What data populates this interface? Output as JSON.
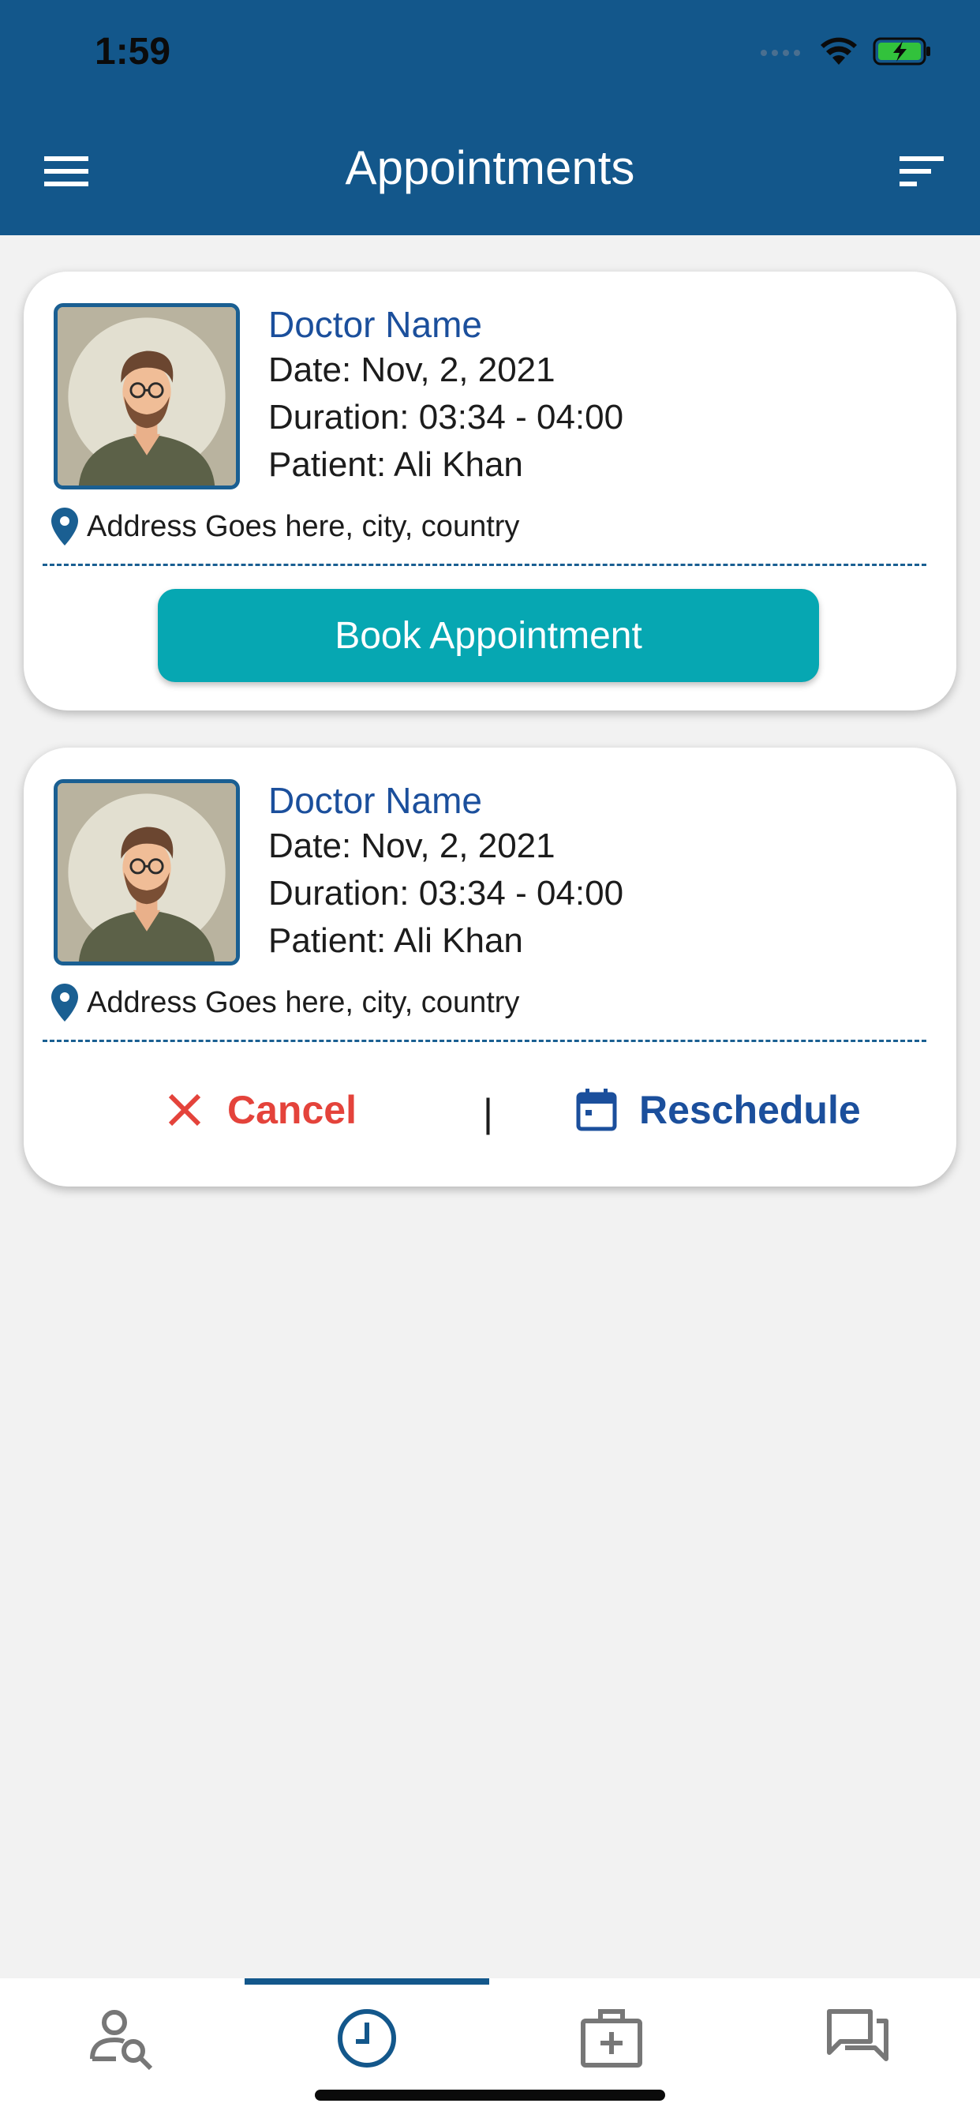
{
  "status_bar": {
    "time": "1:59"
  },
  "header": {
    "title": "Appointments",
    "menu_icon": "hamburger-menu-icon",
    "filter_icon": "filter-sort-icon"
  },
  "colors": {
    "primary": "#13578b",
    "accent_teal": "#06a7b2",
    "doctor_name": "#1b4f9c",
    "cancel_red": "#e4433b",
    "background": "#f2f2f2"
  },
  "cards": [
    {
      "doctor_name": "Doctor Name",
      "date": "Date: Nov, 2, 2021",
      "duration": "Duration: 03:34 - 04:00",
      "patient": "Patient: Ali Khan",
      "address": "Address Goes here, city, country",
      "action_label": "Book Appointment"
    },
    {
      "doctor_name": "Doctor Name",
      "date": "Date: Nov, 2, 2021",
      "duration": "Duration: 03:34 - 04:00",
      "patient": "Patient: Ali Khan",
      "address": "Address Goes here, city, country",
      "cancel_label": "Cancel",
      "separator": "|",
      "reschedule_label": "Reschedule"
    }
  ],
  "bottom_nav": {
    "items": [
      {
        "icon": "find-doctor-icon",
        "active": false
      },
      {
        "icon": "clock-icon",
        "active": true
      },
      {
        "icon": "medical-kit-icon",
        "active": false
      },
      {
        "icon": "chat-icon",
        "active": false
      }
    ]
  }
}
